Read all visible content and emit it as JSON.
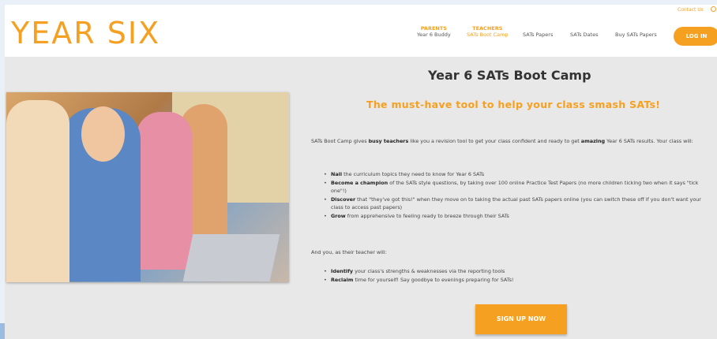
{
  "header": {
    "logo": "YEAR SIX",
    "contact": "Contact Us",
    "nav": [
      {
        "group": "PARENTS",
        "label": "Year 6 Buddy"
      },
      {
        "group": "TEACHERS",
        "label": "SATs Boot Camp"
      },
      {
        "label": "SATs Papers"
      },
      {
        "label": "SATs Dates"
      },
      {
        "label": "Buy SATs Papers"
      }
    ],
    "login": "LOG IN"
  },
  "main": {
    "title": "Year 6 SATs Boot Camp",
    "subtitle": "The must-have tool to help your class smash SATs!",
    "intro": {
      "pre": "SATs Boot Camp gives ",
      "b1": "busy teachers",
      "mid": " like you a revision tool to get your class confident and ready to get ",
      "b2": "amazing",
      "post": " Year 6 SATs results. Your class will:"
    },
    "list1": [
      {
        "bold": "Nail",
        "text": " the curriculum topics they need to know for Year 6 SATs"
      },
      {
        "bold": "Become a champion",
        "text": " of the SATs style questions, by taking over 100 online Practice Test Papers (no more children ticking two when it says \"tick one\"!)"
      },
      {
        "bold": "Discover",
        "text": " that \"they've got this!\" when they move on to taking the actual past SATs papers online (you can switch these off if you don't want your class to access past papers)"
      },
      {
        "bold": "Grow",
        "text": " from apprehensive to feeling ready to breeze through their SATs"
      }
    ],
    "para2": "And you, as their teacher will:",
    "list2": [
      {
        "bold": "Identify",
        "text": " your class's strengths & weaknesses via the reporting tools"
      },
      {
        "bold": "Reclaim",
        "text": " time for yourself! Say goodbye to evenings preparing for SATs!"
      }
    ],
    "signup": "SIGN UP NOW"
  }
}
